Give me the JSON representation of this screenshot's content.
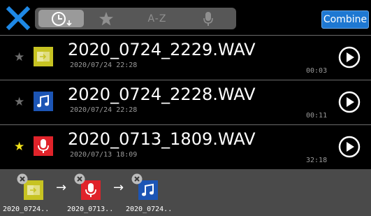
{
  "header": {
    "close_icon": "close-icon",
    "sort_tabs": [
      {
        "icon": "clock-sort-icon",
        "active": true
      },
      {
        "icon": "star-icon",
        "active": false
      },
      {
        "label": "A-Z",
        "active": false
      },
      {
        "icon": "microphone-icon",
        "active": false
      }
    ],
    "combine_label": "Combine"
  },
  "files": [
    {
      "name": "2020_0724_2229.WAV",
      "date": "2020/07/24 22:28",
      "duration": "00:03",
      "favorite": false,
      "type": "combined-file-icon",
      "type_color": "#c7c322"
    },
    {
      "name": "2020_0724_2228.WAV",
      "date": "2020/07/24 22:28",
      "duration": "00:11",
      "favorite": false,
      "type": "music-note-icon",
      "type_color": "#1c55b5"
    },
    {
      "name": "2020_0713_1809.WAV",
      "date": "2020/07/13 18:09",
      "duration": "32:18",
      "favorite": true,
      "type": "microphone-icon",
      "type_color": "#e0232a"
    }
  ],
  "tray": {
    "items": [
      {
        "label": "2020_0724..",
        "type": "combined-file-icon"
      },
      {
        "label": "2020_0713..",
        "type": "microphone-icon"
      },
      {
        "label": "2020_0724..",
        "type": "music-note-icon"
      }
    ],
    "arrow": "→"
  },
  "colors": {
    "accent": "#1e78d2",
    "favorite_star": "#f2e21a",
    "close_x": "#1e88e5"
  }
}
